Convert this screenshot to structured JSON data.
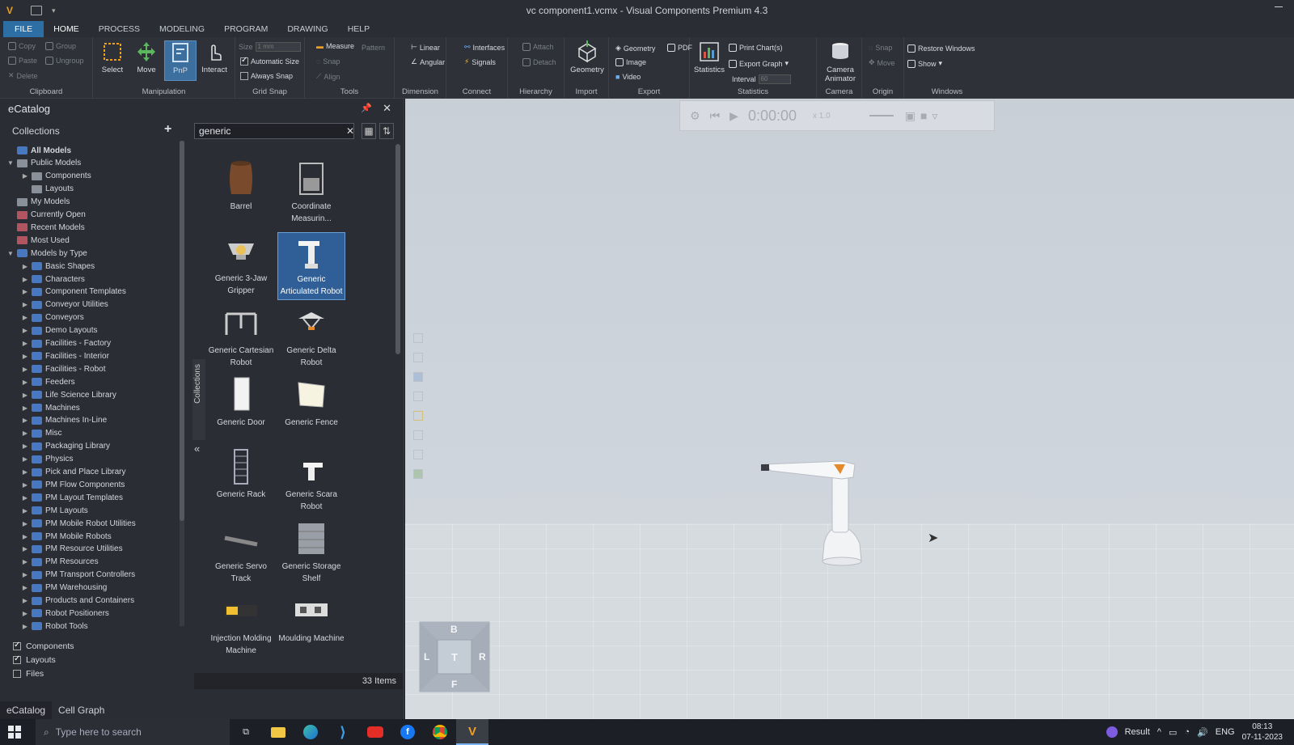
{
  "window": {
    "title": "vc component1.vcmx - Visual Components Premium 4.3"
  },
  "menu": [
    "FILE",
    "HOME",
    "PROCESS",
    "MODELING",
    "PROGRAM",
    "DRAWING",
    "HELP"
  ],
  "ribbon": {
    "clipboard": {
      "label": "Clipboard",
      "copy": "Copy",
      "paste": "Paste",
      "delete": "Delete",
      "group": "Group",
      "ungroup": "Ungroup"
    },
    "manipulation": {
      "label": "Manipulation",
      "select": "Select",
      "move": "Move",
      "pnp": "PnP",
      "interact": "Interact"
    },
    "gridsnap": {
      "label": "Grid Snap",
      "size": "Size",
      "size_value": "1",
      "size_unit": "mm",
      "automatic_size": "Automatic Size",
      "always_snap": "Always Snap"
    },
    "tools": {
      "label": "Tools",
      "measure": "Measure",
      "pattern": "Pattern",
      "snap": "Snap",
      "align": "Align"
    },
    "dimension": {
      "label": "Dimension",
      "linear": "Linear",
      "angular": "Angular"
    },
    "connect": {
      "label": "Connect",
      "interfaces": "Interfaces",
      "signals": "Signals"
    },
    "hierarchy": {
      "label": "Hierarchy",
      "attach": "Attach",
      "detach": "Detach"
    },
    "import": {
      "label": "Import",
      "geometry": "Geometry"
    },
    "export": {
      "label": "Export",
      "geometry": "Geometry",
      "pdf": "PDF",
      "image": "Image",
      "video": "Video"
    },
    "statistics": {
      "label": "Statistics",
      "statistics": "Statistics",
      "print_charts": "Print Chart(s)",
      "export_graph": "Export Graph",
      "interval": "Interval",
      "interval_value": "60"
    },
    "camera": {
      "label": "Camera",
      "camera_animator": "Camera Animator"
    },
    "origin": {
      "label": "Origin",
      "snap": "Snap",
      "move": "Move"
    },
    "windows": {
      "label": "Windows",
      "restore": "Restore Windows",
      "show": "Show"
    }
  },
  "catalog": {
    "title": "eCatalog",
    "collections_label": "Collections",
    "search_value": "generic",
    "side_tab": "Collections",
    "tree": [
      {
        "label": "All Models",
        "level": 1,
        "icon": "cat",
        "bold": true
      },
      {
        "label": "Public Models",
        "level": 1,
        "icon": "grey",
        "expanded": true
      },
      {
        "label": "Components",
        "level": 2,
        "icon": "grey",
        "arrow": true
      },
      {
        "label": "Layouts",
        "level": 2,
        "icon": "grey"
      },
      {
        "label": "My Models",
        "level": 1,
        "icon": "grey"
      },
      {
        "label": "Currently Open",
        "level": 1,
        "icon": "red"
      },
      {
        "label": "Recent Models",
        "level": 1,
        "icon": "red"
      },
      {
        "label": "Most Used",
        "level": 1,
        "icon": "red"
      },
      {
        "label": "Models by Type",
        "level": 1,
        "icon": "cat",
        "expanded": true
      },
      {
        "label": "Basic Shapes",
        "level": 2,
        "icon": "cat",
        "arrow": true
      },
      {
        "label": "Characters",
        "level": 2,
        "icon": "cat",
        "arrow": true
      },
      {
        "label": "Component Templates",
        "level": 2,
        "icon": "cat",
        "arrow": true
      },
      {
        "label": "Conveyor Utilities",
        "level": 2,
        "icon": "cat",
        "arrow": true
      },
      {
        "label": "Conveyors",
        "level": 2,
        "icon": "cat",
        "arrow": true
      },
      {
        "label": "Demo Layouts",
        "level": 2,
        "icon": "cat",
        "arrow": true
      },
      {
        "label": "Facilities - Factory",
        "level": 2,
        "icon": "cat",
        "arrow": true
      },
      {
        "label": "Facilities - Interior",
        "level": 2,
        "icon": "cat",
        "arrow": true
      },
      {
        "label": "Facilities - Robot",
        "level": 2,
        "icon": "cat",
        "arrow": true
      },
      {
        "label": "Feeders",
        "level": 2,
        "icon": "cat",
        "arrow": true
      },
      {
        "label": "Life Science Library",
        "level": 2,
        "icon": "cat",
        "arrow": true
      },
      {
        "label": "Machines",
        "level": 2,
        "icon": "cat",
        "arrow": true
      },
      {
        "label": "Machines In-Line",
        "level": 2,
        "icon": "cat",
        "arrow": true
      },
      {
        "label": "Misc",
        "level": 2,
        "icon": "cat",
        "arrow": true
      },
      {
        "label": "Packaging Library",
        "level": 2,
        "icon": "cat",
        "arrow": true
      },
      {
        "label": "Physics",
        "level": 2,
        "icon": "cat",
        "arrow": true
      },
      {
        "label": "Pick and Place Library",
        "level": 2,
        "icon": "cat",
        "arrow": true
      },
      {
        "label": "PM Flow Components",
        "level": 2,
        "icon": "cat",
        "arrow": true
      },
      {
        "label": "PM Layout Templates",
        "level": 2,
        "icon": "cat",
        "arrow": true
      },
      {
        "label": "PM Layouts",
        "level": 2,
        "icon": "cat",
        "arrow": true
      },
      {
        "label": "PM Mobile Robot Utilities",
        "level": 2,
        "icon": "cat",
        "arrow": true
      },
      {
        "label": "PM Mobile Robots",
        "level": 2,
        "icon": "cat",
        "arrow": true
      },
      {
        "label": "PM Resource Utilities",
        "level": 2,
        "icon": "cat",
        "arrow": true
      },
      {
        "label": "PM Resources",
        "level": 2,
        "icon": "cat",
        "arrow": true
      },
      {
        "label": "PM Transport Controllers",
        "level": 2,
        "icon": "cat",
        "arrow": true
      },
      {
        "label": "PM Warehousing",
        "level": 2,
        "icon": "cat",
        "arrow": true
      },
      {
        "label": "Products and Containers",
        "level": 2,
        "icon": "cat",
        "arrow": true
      },
      {
        "label": "Robot Positioners",
        "level": 2,
        "icon": "cat",
        "arrow": true
      },
      {
        "label": "Robot Tools",
        "level": 2,
        "icon": "cat",
        "arrow": true
      }
    ],
    "filters": [
      {
        "label": "Components",
        "checked": true
      },
      {
        "label": "Layouts",
        "checked": true
      },
      {
        "label": "Files",
        "checked": false
      }
    ],
    "items": [
      {
        "label": "Barrel",
        "icon": "barrel-icon"
      },
      {
        "label": "Coordinate Measurin...",
        "icon": "cmm-icon"
      },
      {
        "label": "Generic 3-Jaw Gripper",
        "icon": "gripper-icon"
      },
      {
        "label": "Generic Articulated Robot",
        "icon": "articulated-robot-icon",
        "selected": true
      },
      {
        "label": "Generic Cartesian Robot",
        "icon": "cartesian-robot-icon"
      },
      {
        "label": "Generic Delta Robot",
        "icon": "delta-robot-icon"
      },
      {
        "label": "Generic Door",
        "icon": "door-icon"
      },
      {
        "label": "Generic Fence",
        "icon": "fence-icon"
      },
      {
        "label": "Generic Rack",
        "icon": "rack-icon"
      },
      {
        "label": "Generic Scara Robot",
        "icon": "scara-robot-icon"
      },
      {
        "label": "Generic Servo Track",
        "icon": "servo-track-icon"
      },
      {
        "label": "Generic Storage Shelf",
        "icon": "storage-shelf-icon"
      },
      {
        "label": "Injection Molding Machine",
        "icon": "injection-molding-icon"
      },
      {
        "label": "Moulding Machine",
        "icon": "moulding-machine-icon"
      }
    ],
    "item_count": "33 Items",
    "bottom_tabs": [
      "eCatalog",
      "Cell Graph"
    ]
  },
  "viewport": {
    "time": "0:00:00",
    "speed": "x 1.0",
    "navcube": {
      "top": "B",
      "left": "L",
      "center": "T",
      "right": "R",
      "bottom": "F"
    }
  },
  "taskbar": {
    "search_placeholder": "Type here to search",
    "result_label": "Result",
    "language": "ENG",
    "time": "08:13",
    "date": "07-11-2023"
  }
}
